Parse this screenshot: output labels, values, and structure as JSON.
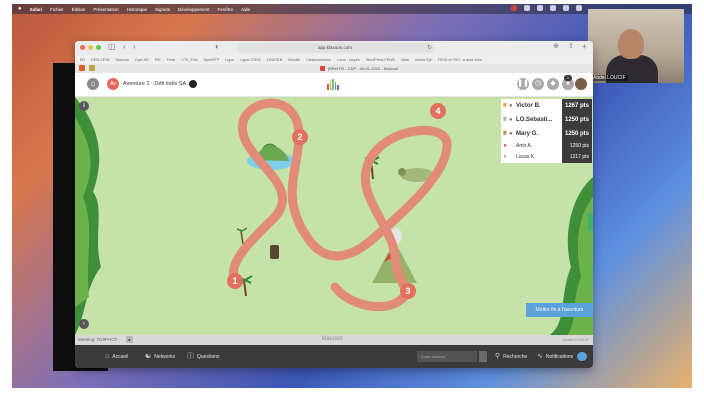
{
  "macos": {
    "menu_items": [
      "Safari",
      "Fichier",
      "Édition",
      "Présentation",
      "Historique",
      "Signets",
      "Développement",
      "Fenêtre",
      "Aide"
    ]
  },
  "video_call": {
    "participant_name": "Abdel LOUCIF"
  },
  "browser": {
    "url": "app.klaxoon.com",
    "bookmarks": [
      "ED",
      "CESI-LEYE",
      "Klaxoon",
      "Capt-HD",
      "PIE",
      "Fenix",
      "CTS_EVA",
      "OpenRTP",
      "Ligue",
      "Ligue-TOEIC",
      "LINXTEN",
      "Moodle",
      "Classcorrection",
      "Loom - Inspire",
      "WordPress FEWD",
      "Vidal",
      "Adobe Eyt",
      "FEHD et FHS - a avoir lu/vu"
    ],
    "tab_title": "[BRef R2 - CDP - 09-01-2020 - Klaxoon"
  },
  "app_header": {
    "adventure_avatar_text": "Av",
    "adventure_title": "Aventure 1 - Défi Indiv SA...",
    "notification_count": "1"
  },
  "map": {
    "stops": [
      "1",
      "2",
      "3",
      "4"
    ]
  },
  "leaderboard": [
    {
      "name": "Victor B.",
      "points": "1267 pts",
      "rank_icon": "gold-trophy-icon"
    },
    {
      "name": "LO.Sebasti...",
      "points": "1250 pts",
      "rank_icon": "silver-trophy-icon"
    },
    {
      "name": "Mary G.",
      "points": "1250 pts",
      "rank_icon": "bronze-trophy-icon"
    },
    {
      "name": "Amir A.",
      "points": "1250 pts",
      "rank_icon": "medal-icon"
    },
    {
      "name": "Lucas K.",
      "points": "1217 pts",
      "rank_icon": "user-icon"
    }
  ],
  "cta": {
    "label": "Mettre fin à l'aventure"
  },
  "status_strip": {
    "meeting_label": "Meeting: 7G8PHCF",
    "brand": "klaxoon",
    "right_text": "Abdel LOUCIF"
  },
  "bottom_nav": {
    "home": "Accueil",
    "networks": "Networks",
    "questions": "Questions",
    "code_placeholder": "Code d'accès",
    "search": "Recherche",
    "notifications": "Notifications"
  },
  "colors": {
    "path": "#e28b7b",
    "map_bg": "#c5e3a9",
    "bottom_bar": "#3b3b3b",
    "accent": "#5aa2d8",
    "points_bg": "#3b3b3b"
  }
}
